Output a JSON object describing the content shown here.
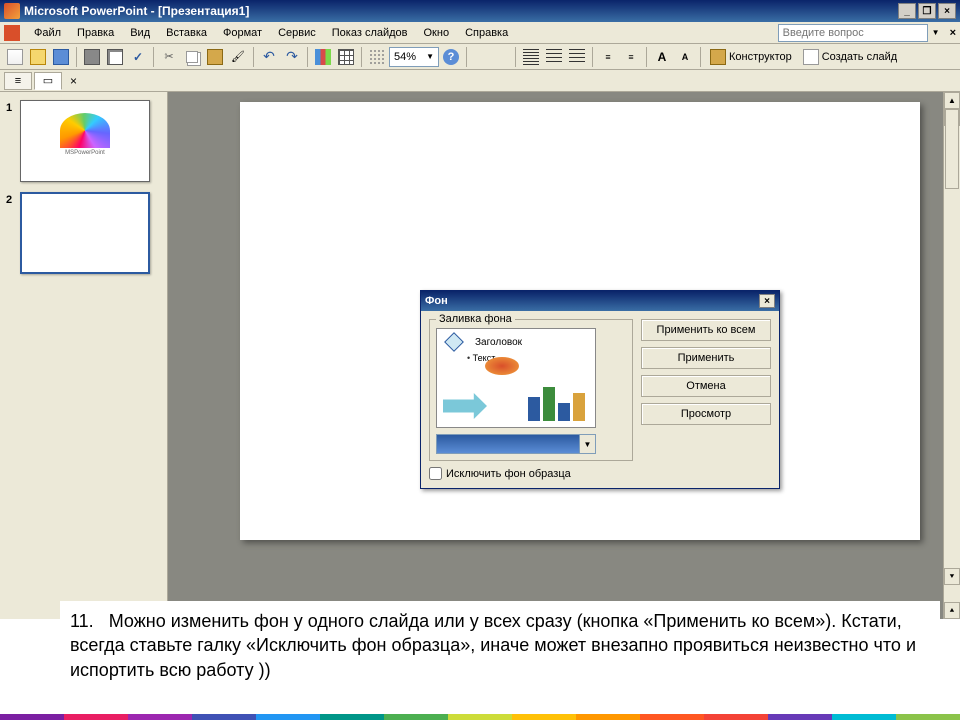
{
  "titlebar": {
    "title": "Microsoft PowerPoint - [Презентация1]"
  },
  "menubar": {
    "items": [
      "Файл",
      "Правка",
      "Вид",
      "Вставка",
      "Формат",
      "Сервис",
      "Показ слайдов",
      "Окно",
      "Справка"
    ],
    "help_placeholder": "Введите вопрос"
  },
  "toolbar": {
    "zoom": "54%",
    "designer_label": "Конструктор",
    "newslide_label": "Создать слайд"
  },
  "thumbs": [
    {
      "num": "1"
    },
    {
      "num": "2"
    }
  ],
  "dialog": {
    "title": "Фон",
    "group_label": "Заливка фона",
    "preview_title": "Заголовок",
    "preview_text": "Текст",
    "checkbox_label": "Исключить фон образца",
    "buttons": {
      "apply_all": "Применить ко всем",
      "apply": "Применить",
      "cancel": "Отмена",
      "preview": "Просмотр"
    }
  },
  "caption": {
    "num": "11.",
    "text": "Можно изменить фон у одного слайда или у всех сразу (кнопка «Применить ко всем»). Кстати, всегда ставьте галку «Исключить фон образца», иначе может внезапно проявиться неизвестно что и испортить всю работу ))"
  },
  "strip_colors": [
    "#7b1fa2",
    "#e91e63",
    "#9c27b0",
    "#3f51b5",
    "#2196f3",
    "#009688",
    "#4caf50",
    "#cddc39",
    "#ffc107",
    "#ff9800",
    "#ff5722",
    "#f44336",
    "#673ab7",
    "#00bcd4",
    "#8bc34a"
  ]
}
